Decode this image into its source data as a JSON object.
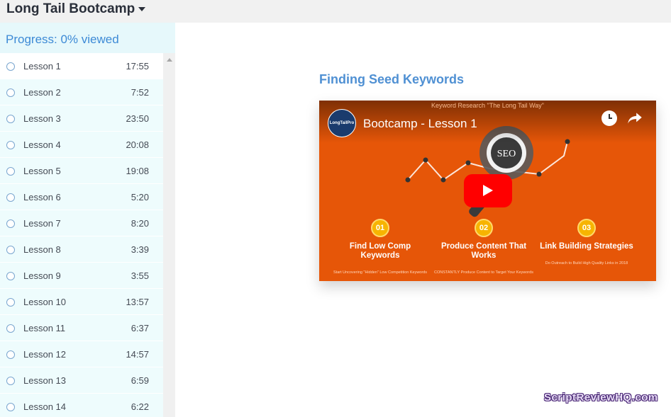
{
  "header": {
    "course_title": "Long Tail Bootcamp"
  },
  "sidebar": {
    "progress_text": "Progress: 0% viewed",
    "lessons": [
      {
        "name": "Lesson 1",
        "duration": "17:55"
      },
      {
        "name": "Lesson 2",
        "duration": "7:52"
      },
      {
        "name": "Lesson 3",
        "duration": "23:50"
      },
      {
        "name": "Lesson 4",
        "duration": "20:08"
      },
      {
        "name": "Lesson 5",
        "duration": "19:08"
      },
      {
        "name": "Lesson 6",
        "duration": "5:20"
      },
      {
        "name": "Lesson 7",
        "duration": "8:20"
      },
      {
        "name": "Lesson 8",
        "duration": "3:39"
      },
      {
        "name": "Lesson 9",
        "duration": "3:55"
      },
      {
        "name": "Lesson 10",
        "duration": "13:57"
      },
      {
        "name": "Lesson 11",
        "duration": "6:37"
      },
      {
        "name": "Lesson 12",
        "duration": "14:57"
      },
      {
        "name": "Lesson 13",
        "duration": "6:59"
      },
      {
        "name": "Lesson 14",
        "duration": "6:22"
      }
    ]
  },
  "main": {
    "lesson_heading": "Finding Seed Keywords",
    "video": {
      "top_caption": "Keyword Research \"The Long Tail Way\"",
      "channel_logo_text": "LongTailPro",
      "title": "Bootcamp - Lesson 1",
      "center_label": "SEO",
      "steps": [
        {
          "num": "01",
          "title": "Find Low Comp Keywords",
          "desc": "Start Uncovering \"Hidden\" Low Competition Keywords"
        },
        {
          "num": "02",
          "title": "Produce Content That Works",
          "desc": "CONSTANTLY Produce Content to Target Your Keywords"
        },
        {
          "num": "03",
          "title": "Link Building Strategies",
          "desc": "Do Outreach to Build High Quality Links in 2018"
        }
      ]
    }
  },
  "watermark": "ScriptReviewHQ.com",
  "colors": {
    "accent": "#4f90d3",
    "progress_bg": "#e6f8fb",
    "video_bg": "#e65608",
    "play_red": "#ff0000"
  },
  "icons": {
    "caret": "chevron-down-icon",
    "watch_later": "clock-icon",
    "share": "share-icon",
    "play": "play-icon"
  }
}
